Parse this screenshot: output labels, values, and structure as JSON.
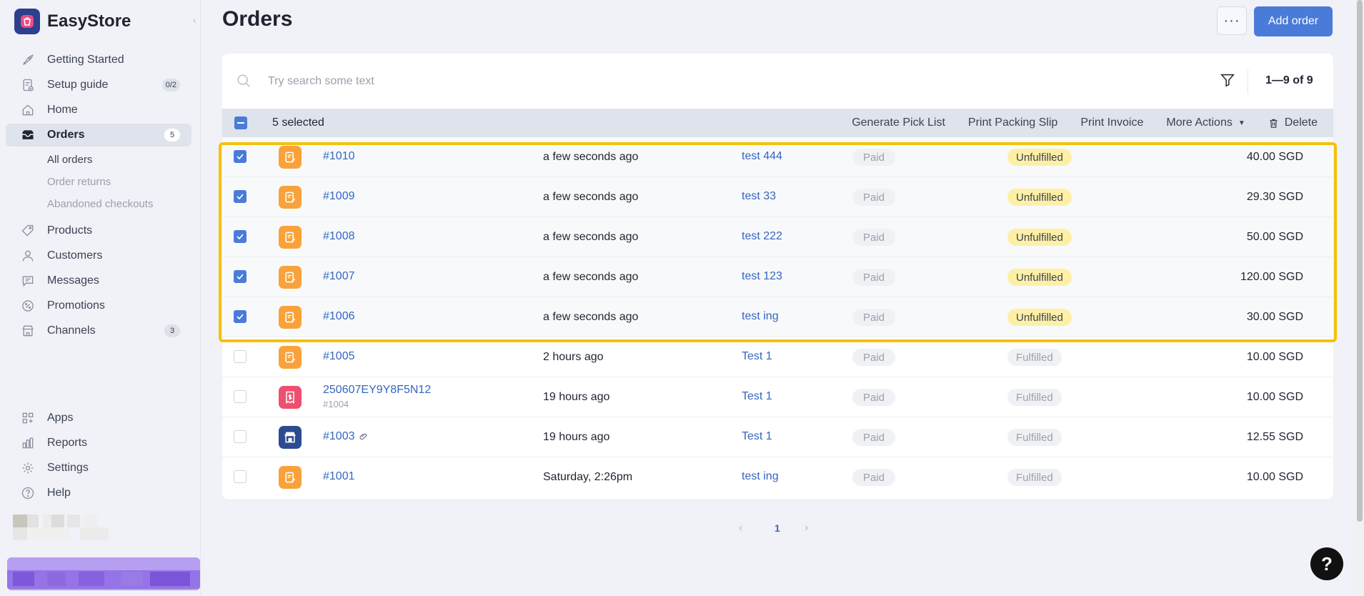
{
  "brand": {
    "name": "EasyStore",
    "logo_color": "#2d3f8f"
  },
  "sidebar": {
    "items": [
      {
        "label": "Getting Started",
        "icon": "rocket-icon"
      },
      {
        "label": "Setup guide",
        "icon": "checklist-icon",
        "badge": "0/2"
      },
      {
        "label": "Home",
        "icon": "home-icon"
      },
      {
        "label": "Orders",
        "icon": "inbox-icon",
        "badge": "5",
        "active": true
      },
      {
        "label": "Products",
        "icon": "tag-icon"
      },
      {
        "label": "Customers",
        "icon": "user-icon"
      },
      {
        "label": "Messages",
        "icon": "chat-icon"
      },
      {
        "label": "Promotions",
        "icon": "discount-icon"
      },
      {
        "label": "Channels",
        "icon": "store-icon",
        "badge": "3"
      }
    ],
    "orders_sub": [
      {
        "label": "All orders",
        "current": true
      },
      {
        "label": "Order returns"
      },
      {
        "label": "Abandoned checkouts"
      }
    ],
    "bottom_items": [
      {
        "label": "Apps",
        "icon": "apps-icon"
      },
      {
        "label": "Reports",
        "icon": "bar-chart-icon"
      },
      {
        "label": "Settings",
        "icon": "gear-icon"
      },
      {
        "label": "Help",
        "icon": "question-icon"
      }
    ]
  },
  "header": {
    "title": "Orders",
    "more_label": "···",
    "add_label": "Add order"
  },
  "search": {
    "placeholder": "Try search some text"
  },
  "pagination_text": "1—9 of 9",
  "bulk": {
    "selected": "5 selected",
    "actions": [
      "Generate Pick List",
      "Print Packing Slip",
      "Print Invoice",
      "More Actions"
    ],
    "delete_label": "Delete"
  },
  "orders": [
    {
      "number": "#1010",
      "date": "a few seconds ago",
      "customer": "test 444",
      "payment": "Paid",
      "fulfillment": "Unfulfilled",
      "total": "40.00 SGD",
      "selected": true,
      "source": "order-form-icon"
    },
    {
      "number": "#1009",
      "date": "a few seconds ago",
      "customer": "test 33",
      "payment": "Paid",
      "fulfillment": "Unfulfilled",
      "total": "29.30 SGD",
      "selected": true,
      "source": "order-form-icon"
    },
    {
      "number": "#1008",
      "date": "a few seconds ago",
      "customer": "test 222",
      "payment": "Paid",
      "fulfillment": "Unfulfilled",
      "total": "50.00 SGD",
      "selected": true,
      "source": "order-form-icon"
    },
    {
      "number": "#1007",
      "date": "a few seconds ago",
      "customer": "test 123",
      "payment": "Paid",
      "fulfillment": "Unfulfilled",
      "total": "120.00 SGD",
      "selected": true,
      "source": "order-form-icon"
    },
    {
      "number": "#1006",
      "date": "a few seconds ago",
      "customer": "test ing",
      "payment": "Paid",
      "fulfillment": "Unfulfilled",
      "total": "30.00 SGD",
      "selected": true,
      "source": "order-form-icon"
    },
    {
      "number": "#1005",
      "date": "2 hours ago",
      "customer": "Test 1",
      "payment": "Paid",
      "fulfillment": "Fulfilled",
      "total": "10.00 SGD",
      "selected": false,
      "source": "order-form-icon"
    },
    {
      "number": "250607EY9Y8F5N12",
      "sub": "#1004",
      "date": "19 hours ago",
      "customer": "Test 1",
      "payment": "Paid",
      "fulfillment": "Fulfilled",
      "total": "10.00 SGD",
      "selected": false,
      "source": "receipt-icon"
    },
    {
      "number": "#1003",
      "date": "19 hours ago",
      "customer": "Test 1",
      "payment": "Paid",
      "fulfillment": "Fulfilled",
      "total": "12.55 SGD",
      "selected": false,
      "source": "pos-store-icon",
      "attachment": true
    },
    {
      "number": "#1001",
      "date": "Saturday, 2:26pm",
      "customer": "test ing",
      "payment": "Paid",
      "fulfillment": "Fulfilled",
      "total": "10.00 SGD",
      "selected": false,
      "source": "order-form-icon"
    }
  ],
  "page": {
    "current": "1"
  },
  "help_fab": "?",
  "colors": {
    "primary": "#4a7bd8",
    "link": "#3566c0",
    "unfulfilled_bg": "#fdf0a6",
    "highlight": "#f6c108",
    "order_form_bg": "#f9a23b",
    "receipt_bg": "#ef4f6f",
    "pos_bg": "#2d4b93"
  }
}
